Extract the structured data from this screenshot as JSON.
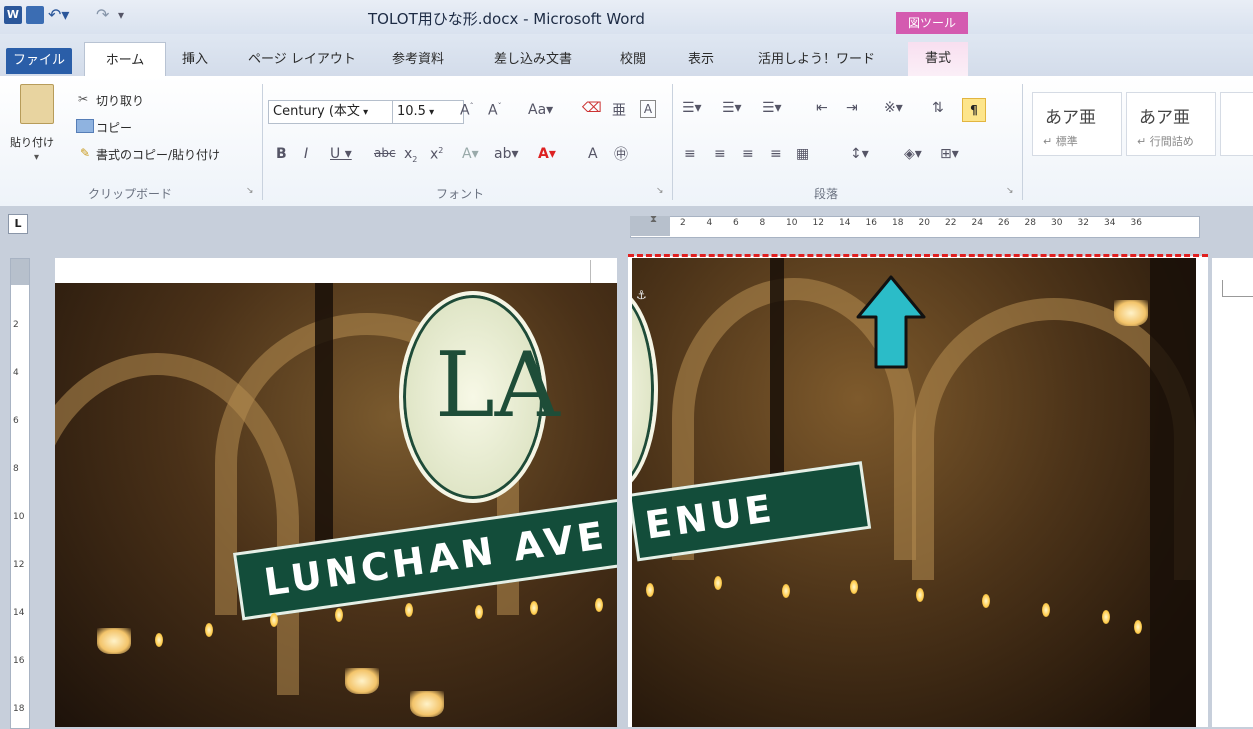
{
  "window": {
    "title": "TOLOT用ひな形.docx - Microsoft Word",
    "contextual_tab_title": "図ツール",
    "app_icon_letter": "W"
  },
  "tabs": [
    {
      "label": "ファイル"
    },
    {
      "label": "ホーム"
    },
    {
      "label": "挿入"
    },
    {
      "label": "ページ レイアウト"
    },
    {
      "label": "参考資料"
    },
    {
      "label": "差し込み文書"
    },
    {
      "label": "校閲"
    },
    {
      "label": "表示"
    },
    {
      "label": "活用しよう！ワード"
    },
    {
      "label": "書式"
    }
  ],
  "clipboard": {
    "paste_label": "貼り付け",
    "cut_label": "切り取り",
    "copy_label": "コピー",
    "format_painter_label": "書式のコピー/貼り付け",
    "group_label": "クリップボード"
  },
  "font": {
    "font_name": "Century (本文",
    "font_size": "10.5",
    "group_label": "フォント"
  },
  "paragraph": {
    "group_label": "段落"
  },
  "styles": [
    {
      "sample": "あア亜",
      "name": "↵ 標準"
    },
    {
      "sample": "あア亜",
      "name": "↵ 行間詰め"
    }
  ],
  "ruler": {
    "ticks": [
      "2",
      "4",
      "6",
      "8",
      "10",
      "12",
      "14",
      "16",
      "18",
      "20",
      "22",
      "24",
      "26",
      "28",
      "30",
      "32",
      "34",
      "36"
    ],
    "v_ticks": [
      "2",
      "4",
      "6",
      "8",
      "10",
      "12",
      "14",
      "16",
      "18"
    ]
  },
  "photo": {
    "logo_text": "LA",
    "sign_left": "LUNCHAN AVE",
    "sign_right": "ENUE"
  },
  "colors": {
    "accent_dash": "#e02020",
    "arrow": "#2bbcc8",
    "sign": "#134d3a"
  }
}
